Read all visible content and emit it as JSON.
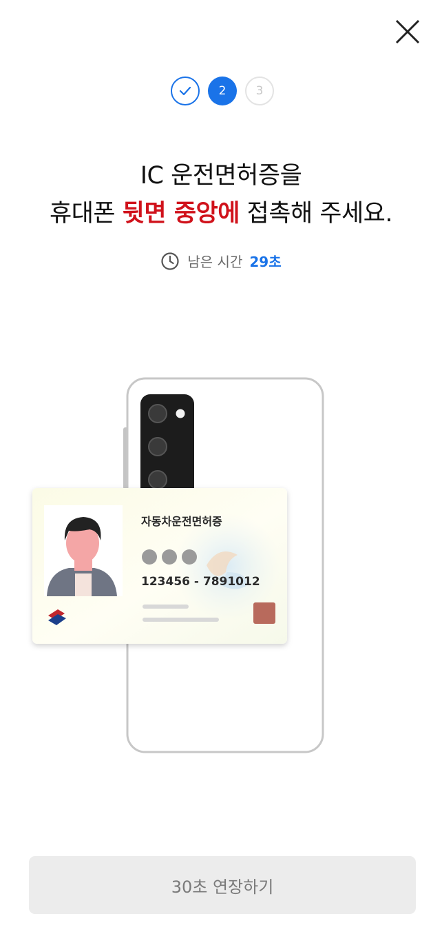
{
  "header": {
    "close_icon": "close-icon"
  },
  "steps": [
    {
      "label": "",
      "state": "done",
      "icon": "check-icon"
    },
    {
      "label": "2",
      "state": "active"
    },
    {
      "label": "3",
      "state": "todo"
    }
  ],
  "instruction": {
    "line1": "IC 운전면허증을",
    "line2_prefix": "휴대폰 ",
    "line2_highlight": "뒷면 중앙에",
    "line2_suffix": " 접촉해 주세요."
  },
  "timer": {
    "icon": "clock-icon",
    "label": "남은 시간",
    "seconds": "29초"
  },
  "card": {
    "title": "자동차운전면허증",
    "number": "123456 - 7891012"
  },
  "colors": {
    "accent": "#1a73e8",
    "highlight": "#d0121b",
    "button_bg": "#ececec"
  },
  "extend_button": {
    "label": "30초 연장하기"
  }
}
